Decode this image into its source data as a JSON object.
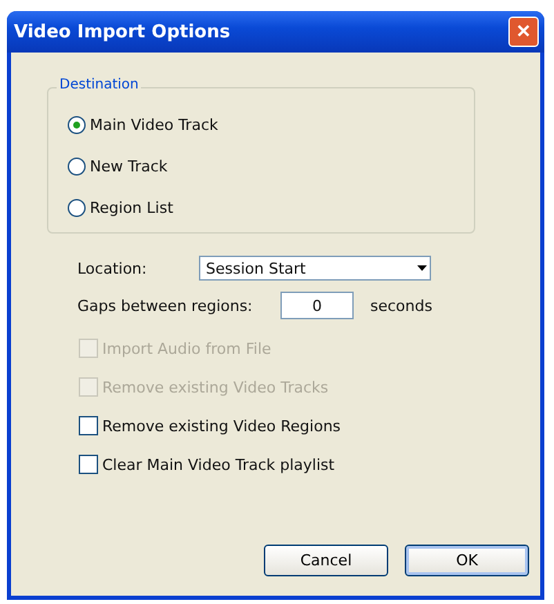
{
  "window": {
    "title": "Video Import Options",
    "close": "✕"
  },
  "destination": {
    "label": "Destination",
    "options": [
      {
        "label": "Main Video Track",
        "selected": true
      },
      {
        "label": "New Track",
        "selected": false
      },
      {
        "label": "Region List",
        "selected": false
      }
    ]
  },
  "location": {
    "label": "Location:",
    "value": "Session Start"
  },
  "gaps": {
    "label": "Gaps between regions:",
    "value": "0",
    "unit": "seconds"
  },
  "checkboxes": [
    {
      "label": "Import Audio from File",
      "checked": false,
      "disabled": true
    },
    {
      "label": "Remove existing Video Tracks",
      "checked": false,
      "disabled": true
    },
    {
      "label": "Remove existing Video Regions",
      "checked": false,
      "disabled": false
    },
    {
      "label": "Clear Main Video Track playlist",
      "checked": false,
      "disabled": false
    }
  ],
  "buttons": [
    {
      "label": "Cancel",
      "default": false
    },
    {
      "label": "OK",
      "default": true
    }
  ]
}
